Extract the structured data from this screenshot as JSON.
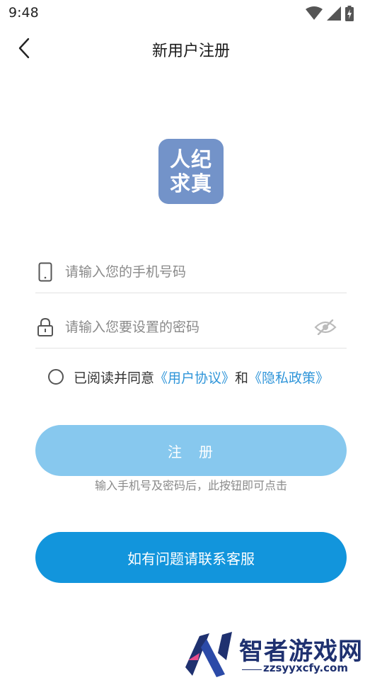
{
  "status_bar": {
    "time": "9:48",
    "icons": [
      "wifi-icon",
      "cell-signal-icon",
      "battery-icon"
    ]
  },
  "header": {
    "title": "新用户注册",
    "back_icon": "chevron-left-icon"
  },
  "logo": {
    "line1": "人纪",
    "line2": "求真",
    "color": "#7393c9"
  },
  "form": {
    "phone_placeholder": "请输入您的手机号码",
    "phone_value": "",
    "password_placeholder": "请输入您要设置的密码",
    "password_value": "",
    "agreement_prefix": "已阅读并同意",
    "user_agreement": "《用户协议》",
    "agreement_and": "和",
    "privacy_policy": "《隐私政策》",
    "register_label": "注　册",
    "register_hint": "输入手机号及密码后，此按钮即可点击",
    "service_label": "如有问题请联系客服"
  },
  "watermark": {
    "title": "智者游戏网",
    "url": "zzsyyxcfy.com"
  },
  "colors": {
    "link": "#2f95d9",
    "register_disabled": "#87c8ee",
    "service": "#1295dc",
    "watermark": "#1f3170"
  }
}
